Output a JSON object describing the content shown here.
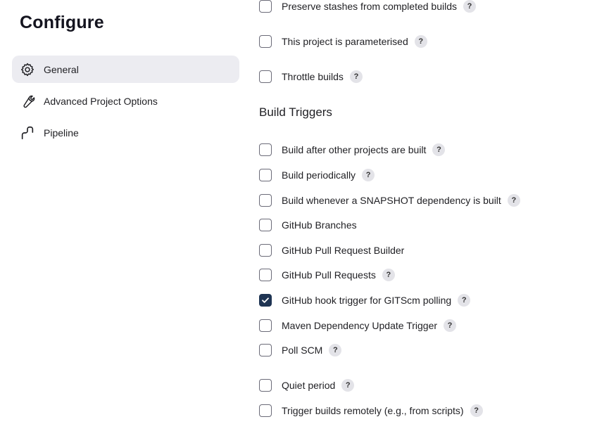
{
  "page": {
    "title": "Configure"
  },
  "sidebar": {
    "items": [
      {
        "label": "General",
        "icon": "gear-icon",
        "active": true
      },
      {
        "label": "Advanced Project Options",
        "icon": "wrench-icon",
        "active": false
      },
      {
        "label": "Pipeline",
        "icon": "pipeline-icon",
        "active": false
      }
    ]
  },
  "general": {
    "options": [
      {
        "label": "Preserve stashes from completed builds",
        "checked": false,
        "help": "?"
      },
      {
        "label": "This project is parameterised",
        "checked": false,
        "help": "?"
      },
      {
        "label": "Throttle builds",
        "checked": false,
        "help": "?"
      }
    ]
  },
  "build_triggers": {
    "title": "Build Triggers",
    "options": [
      {
        "label": "Build after other projects are built",
        "checked": false,
        "help": "?"
      },
      {
        "label": "Build periodically",
        "checked": false,
        "help": "?"
      },
      {
        "label": "Build whenever a SNAPSHOT dependency is built",
        "checked": false,
        "help": "?"
      },
      {
        "label": "GitHub Branches",
        "checked": false,
        "help": null
      },
      {
        "label": "GitHub Pull Request Builder",
        "checked": false,
        "help": null
      },
      {
        "label": "GitHub Pull Requests",
        "checked": false,
        "help": "?"
      },
      {
        "label": "GitHub hook trigger for GITScm polling",
        "checked": true,
        "help": "?"
      },
      {
        "label": "Maven Dependency Update Trigger",
        "checked": false,
        "help": "?"
      },
      {
        "label": "Poll SCM",
        "checked": false,
        "help": "?"
      },
      {
        "label": "Quiet period",
        "checked": false,
        "help": "?"
      },
      {
        "label": "Trigger builds remotely (e.g., from scripts)",
        "checked": false,
        "help": "?"
      }
    ]
  },
  "colors": {
    "checked": "#1f3453",
    "active_nav": "#ececf1",
    "help_bg": "#e3e3e8"
  }
}
